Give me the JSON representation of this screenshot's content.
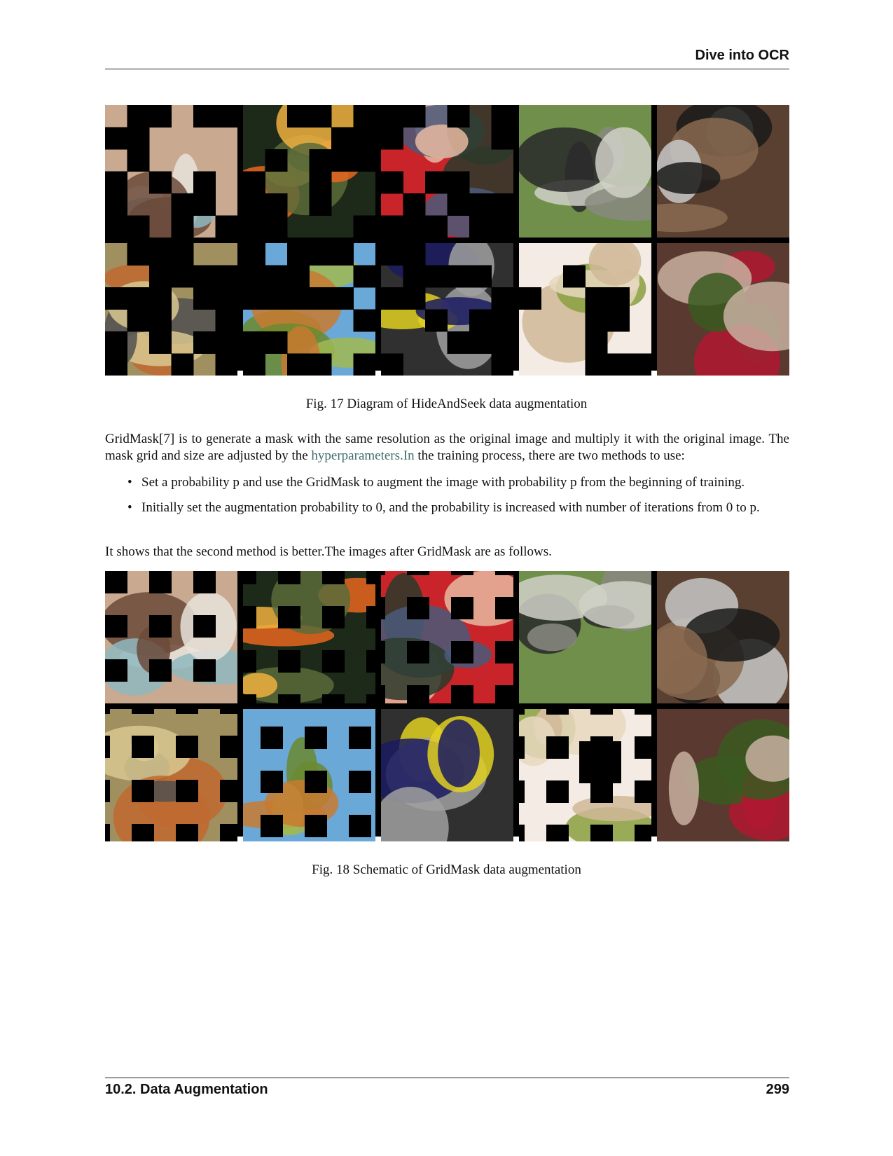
{
  "header": {
    "title": "Dive into OCR"
  },
  "figures": [
    {
      "caption": "Fig. 17 Diagram of HideAndSeek data augmentation",
      "tiles": [
        {
          "subject": "bowl",
          "colors": [
            "#c9a98f",
            "#e8e3dc",
            "#8fb9c0",
            "#6b4a3a"
          ]
        },
        {
          "subject": "goldfish",
          "colors": [
            "#1d2a1a",
            "#e8661e",
            "#f0b040",
            "#5a6b3a"
          ]
        },
        {
          "subject": "child-red-hat",
          "colors": [
            "#c8242a",
            "#2a3a2a",
            "#e8b8a0",
            "#4a5a7a"
          ]
        },
        {
          "subject": "goose",
          "colors": [
            "#6f8f4a",
            "#8a8a80",
            "#2a2a2a",
            "#d0d0c8"
          ]
        },
        {
          "subject": "computer",
          "colors": [
            "#5a4030",
            "#c8c8c8",
            "#1a1a1a",
            "#8a6a50"
          ]
        },
        {
          "subject": "bird",
          "colors": [
            "#a09060",
            "#c06a30",
            "#505050",
            "#d8c890"
          ]
        },
        {
          "subject": "field",
          "colors": [
            "#6aa8d8",
            "#6a8a30",
            "#a0b850",
            "#c87a30"
          ]
        },
        {
          "subject": "race-car",
          "colors": [
            "#303030",
            "#e0d020",
            "#a0a0a0",
            "#1a1a60"
          ]
        },
        {
          "subject": "fruit",
          "colors": [
            "#f4ece4",
            "#8aa040",
            "#e8d8c0",
            "#d0b898"
          ]
        },
        {
          "subject": "roses",
          "colors": [
            "#5a3a30",
            "#b01830",
            "#3a5a20",
            "#c8b0a0"
          ]
        }
      ]
    },
    {
      "caption": "Fig. 18 Schematic of GridMask data augmentation",
      "tiles": [
        {
          "subject": "bowl",
          "colors": [
            "#c9a98f",
            "#e8e3dc",
            "#8fb9c0",
            "#6b4a3a"
          ]
        },
        {
          "subject": "goldfish",
          "colors": [
            "#1d2a1a",
            "#e8661e",
            "#f0b040",
            "#5a6b3a"
          ]
        },
        {
          "subject": "child-red-hat",
          "colors": [
            "#c8242a",
            "#2a3a2a",
            "#e8b8a0",
            "#4a5a7a"
          ]
        },
        {
          "subject": "goose",
          "colors": [
            "#6f8f4a",
            "#8a8a80",
            "#2a2a2a",
            "#d0d0c8"
          ]
        },
        {
          "subject": "computer",
          "colors": [
            "#5a4030",
            "#c8c8c8",
            "#1a1a1a",
            "#8a6a50"
          ]
        },
        {
          "subject": "bird",
          "colors": [
            "#a09060",
            "#c06a30",
            "#505050",
            "#d8c890"
          ]
        },
        {
          "subject": "field",
          "colors": [
            "#6aa8d8",
            "#6a8a30",
            "#a0b850",
            "#c87a30"
          ]
        },
        {
          "subject": "race-car",
          "colors": [
            "#303030",
            "#e0d020",
            "#a0a0a0",
            "#1a1a60"
          ]
        },
        {
          "subject": "fruit",
          "colors": [
            "#f4ece4",
            "#8aa040",
            "#e8d8c0",
            "#d0b898"
          ]
        },
        {
          "subject": "roses",
          "colors": [
            "#5a3a30",
            "#b01830",
            "#3a5a20",
            "#c8b0a0"
          ]
        }
      ]
    }
  ],
  "body": {
    "para1_before": "GridMask[7] is to generate a mask with the same resolution as the original image and multiply it with the original image. The mask grid and size are adjusted by the ",
    "para1_link": "hyperparameters.In",
    "para1_after": " the training process, there are two methods to use:",
    "bullets": [
      "Set a probability p and use the GridMask to augment the image with probability p from the beginning of training.",
      "Initially set the augmentation probability to 0, and the probability is increased with number of iterations from 0 to p."
    ],
    "para2": "It shows that the second method is better.The images after GridMask are as follows."
  },
  "footer": {
    "section": "10.2.  Data Augmentation",
    "page": "299"
  },
  "colors": {
    "link": "#3d6d6d",
    "mask": "#000000"
  }
}
